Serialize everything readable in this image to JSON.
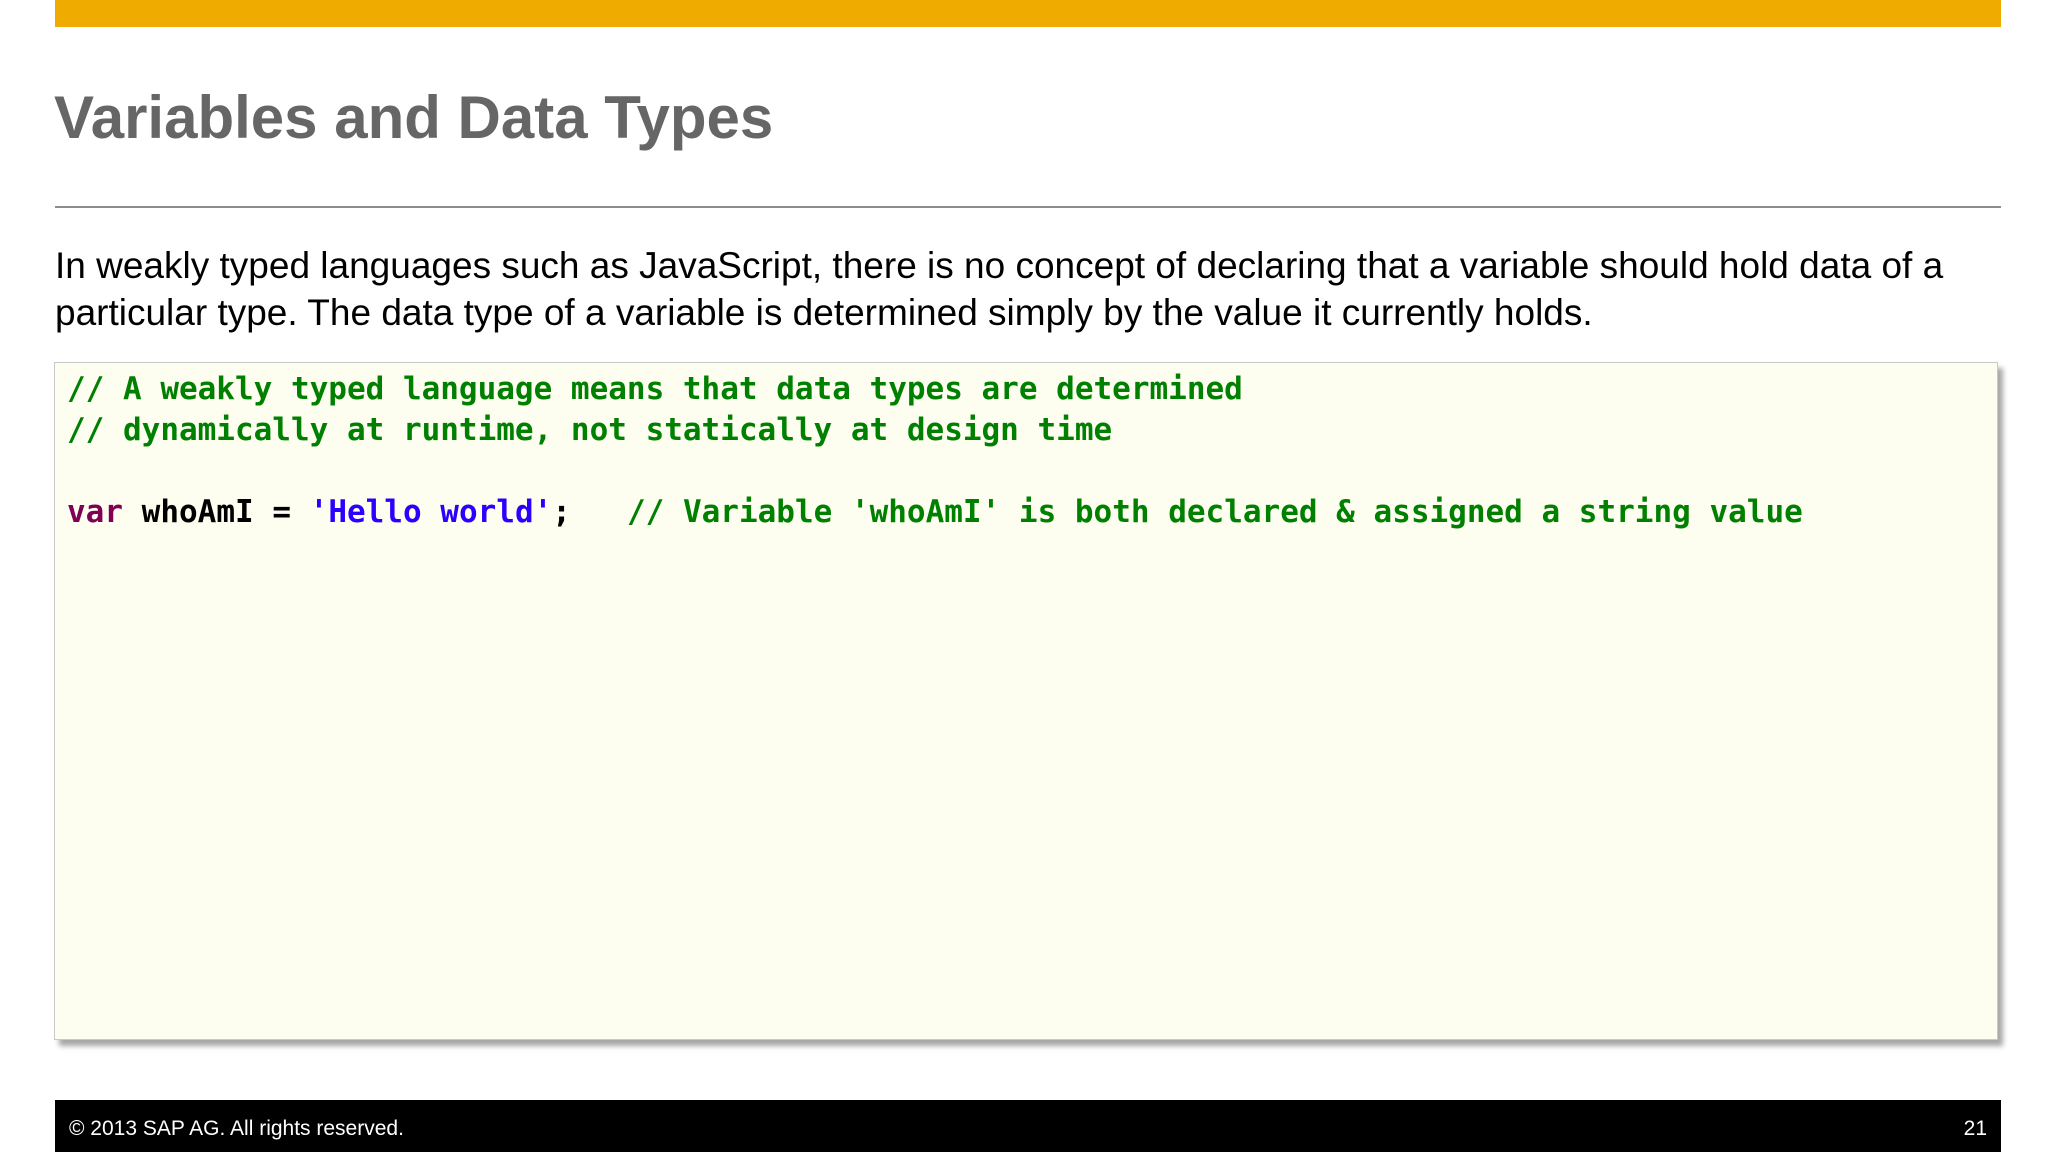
{
  "slide": {
    "title": "Variables and Data Types",
    "body_text": "In weakly typed languages such as JavaScript, there is no concept of declaring that a variable should hold data of a particular type.  The data type of a variable is determined simply by the value it currently holds.",
    "colors": {
      "accent_bar": "#f0ab00",
      "code_background": "#fefef0",
      "comment": "#008000",
      "keyword": "#7f0055",
      "string": "#2a00ff"
    }
  },
  "code": {
    "comment_line_1": "// A weakly typed language means that data types are determined",
    "comment_line_2": "// dynamically at runtime, not statically at design time",
    "keyword": "var",
    "identifier": "whoAmI",
    "assign_op": " = ",
    "string_literal": "'Hello world'",
    "terminator": ";",
    "trailing_comment": "// Variable 'whoAmI' is both declared & assigned a string value"
  },
  "footer": {
    "copyright": "© 2013 SAP AG. All rights reserved.",
    "page_number": "21"
  }
}
